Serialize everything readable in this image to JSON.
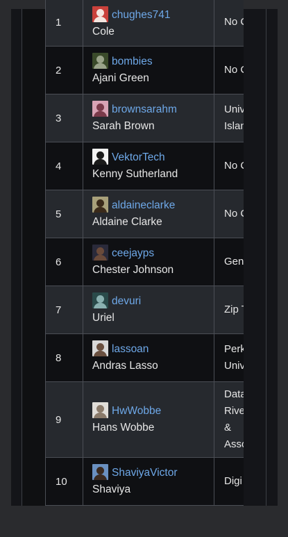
{
  "rows": [
    {
      "rank": "1",
      "username": "chughes741",
      "fullname": "Cole",
      "affiliation": "No C",
      "avatar_bg": "#c9413b",
      "avatar_fg": "#f3e6e0"
    },
    {
      "rank": "2",
      "username": "bombies",
      "fullname": "Ajani Green",
      "affiliation": "No C",
      "avatar_bg": "#3a4a2a",
      "avatar_fg": "#9aa38a"
    },
    {
      "rank": "3",
      "username": "brownsarahm",
      "fullname": "Sarah Brown",
      "affiliation": "Univ\nIslan",
      "avatar_bg": "#d9a3b5",
      "avatar_fg": "#7a3a4a"
    },
    {
      "rank": "4",
      "username": "VektorTech",
      "fullname": "Kenny Sutherland",
      "affiliation": "No C",
      "avatar_bg": "#f2f2f2",
      "avatar_fg": "#1a1a1a"
    },
    {
      "rank": "5",
      "username": "aldaineclarke",
      "fullname": "Aldaine Clarke",
      "affiliation": "No C",
      "avatar_bg": "#a8a07a",
      "avatar_fg": "#3a2a1a"
    },
    {
      "rank": "6",
      "username": "ceejayps",
      "fullname": "Chester Johnson",
      "affiliation": "Gen",
      "avatar_bg": "#2a2a3a",
      "avatar_fg": "#6a4a3a"
    },
    {
      "rank": "7",
      "username": "devuri",
      "fullname": "Uriel",
      "affiliation": "Zip T",
      "avatar_bg": "#2a4a4a",
      "avatar_fg": "#8ab0b0"
    },
    {
      "rank": "8",
      "username": "lassoan",
      "fullname": "Andras Lasso",
      "affiliation": "Perk\nUniv",
      "avatar_bg": "#d8d8d8",
      "avatar_fg": "#6a5040"
    },
    {
      "rank": "9",
      "username": "HwWobbe",
      "fullname": "Hans Wobbe",
      "affiliation": "Data\nRive\n&\nAsso",
      "avatar_bg": "#e0ddd8",
      "avatar_fg": "#8a7a6a"
    },
    {
      "rank": "10",
      "username": "ShaviyaVictor",
      "fullname": "Shaviya",
      "affiliation": "Digi",
      "avatar_bg": "#6a90c0",
      "avatar_fg": "#3a2a20"
    }
  ]
}
